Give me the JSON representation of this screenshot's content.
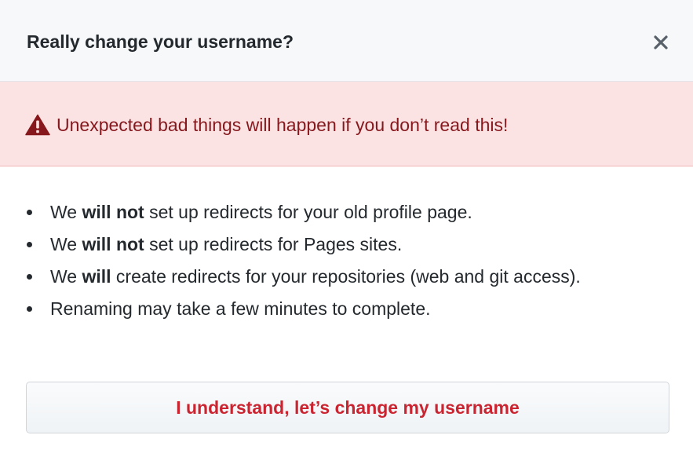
{
  "dialog": {
    "title": "Really change your username?",
    "close_icon": "close-icon"
  },
  "warning": {
    "icon": "alert-triangle-icon",
    "text": "Unexpected bad things will happen if you don’t read this!",
    "color": "#86181d",
    "background": "#fbe3e4"
  },
  "list": {
    "items": [
      {
        "p1": "We ",
        "b1": "will",
        "p2": " ",
        "b2": "not",
        "p3": " set up redirects for your old profile page."
      },
      {
        "p1": "We ",
        "b1": "will",
        "p2": " ",
        "b2": "not",
        "p3": " set up redirects for Pages sites."
      },
      {
        "p1": "We ",
        "b1": "will",
        "p2": " create redirects for your repositories (web and git access).",
        "b2": "",
        "p3": ""
      },
      {
        "p1": "Renaming may take a few minutes to complete.",
        "b1": "",
        "p2": "",
        "b2": "",
        "p3": ""
      }
    ]
  },
  "confirm_button": {
    "label": "I understand, let’s change my username",
    "color": "#cb2431"
  }
}
